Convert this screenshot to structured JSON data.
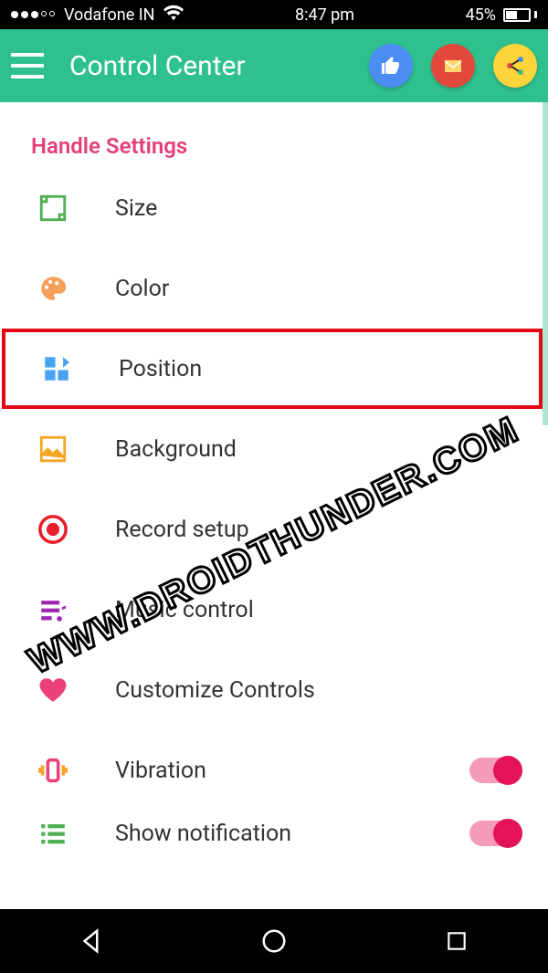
{
  "statusbar": {
    "carrier": "Vodafone IN",
    "time": "8:47 pm",
    "battery_pct": "45%"
  },
  "appbar": {
    "title": "Control Center"
  },
  "section": {
    "title": "Handle Settings"
  },
  "items": [
    {
      "label": "Size"
    },
    {
      "label": "Color"
    },
    {
      "label": "Position"
    },
    {
      "label": "Background"
    },
    {
      "label": "Record setup"
    },
    {
      "label": "Music control"
    },
    {
      "label": "Customize Controls"
    },
    {
      "label": "Vibration"
    },
    {
      "label": "Show notification"
    }
  ],
  "watermark": "WWW.DROIDTHUNDER.COM"
}
